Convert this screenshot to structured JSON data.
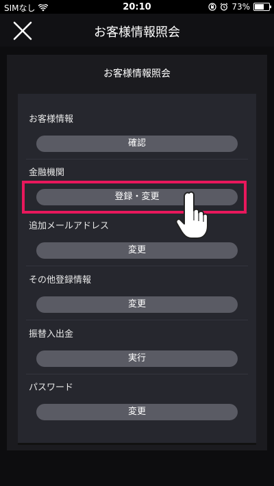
{
  "status_bar": {
    "carrier": "SIMなし",
    "time": "20:10",
    "battery": "73%",
    "battery_level": 0.73
  },
  "header": {
    "title": "お客様情報照会"
  },
  "panel": {
    "title": "お客様情報照会",
    "sections": [
      {
        "label": "お客様情報",
        "button": "確認"
      },
      {
        "label": "金融機関",
        "button": "登録・変更"
      },
      {
        "label": "追加メールアドレス",
        "button": "変更"
      },
      {
        "label": "その他登録情報",
        "button": "変更"
      },
      {
        "label": "振替入出金",
        "button": "実行"
      },
      {
        "label": "パスワード",
        "button": "変更"
      }
    ]
  },
  "colors": {
    "highlight": "#e8185c",
    "button": "#5a5b64",
    "panel": "#26272e"
  },
  "icons": [
    "wifi-icon",
    "orientation-lock-icon",
    "alarm-icon",
    "battery-icon",
    "close-icon",
    "pointing-hand-icon"
  ]
}
